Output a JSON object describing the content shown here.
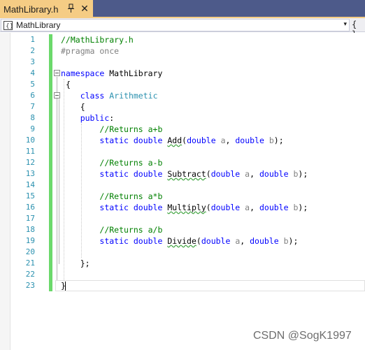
{
  "tab": {
    "title": "MathLibrary.h",
    "pin_icon": "pin-icon",
    "close_icon": "close-icon",
    "close_glyph": "✕"
  },
  "navbar": {
    "scope": "MathLibrary",
    "dropdown_glyph": "▾",
    "braces": "{ }"
  },
  "line_numbers": [
    "1",
    "2",
    "3",
    "4",
    "5",
    "6",
    "7",
    "8",
    "9",
    "10",
    "11",
    "12",
    "13",
    "14",
    "15",
    "16",
    "17",
    "18",
    "19",
    "20",
    "21",
    "22",
    "23"
  ],
  "code": {
    "l1": "//MathLibrary.h",
    "l2": "#pragma once",
    "l4_kw": "namespace",
    "l4_name": " MathLibrary",
    "l5": "{",
    "l6_kw": "class",
    "l6_name": "Arithmetic",
    "l7": "{",
    "l8_kw": "public",
    "l8_colon": ":",
    "l9": "//Returns a+b",
    "l13": "//Returns a-b",
    "l17": "//Returns a*b",
    "l21": "//Returns a/b",
    "static": "static",
    "double": "double",
    "fn_add": "Add",
    "fn_sub": "Subtract",
    "fn_mul": "Multiply",
    "fn_div": "Divide",
    "param_a": "a",
    "param_b": "b",
    "l21_close": "};",
    "l23": "}"
  },
  "watermark": "CSDN @SogK1997",
  "colors": {
    "comment": "#008000",
    "keyword": "#0000ff",
    "type": "#2b91af",
    "preprocessor": "#808080",
    "tab_active": "#f5cc84",
    "tabstrip": "#4d5a8a",
    "change_bar": "#6bd96b"
  }
}
